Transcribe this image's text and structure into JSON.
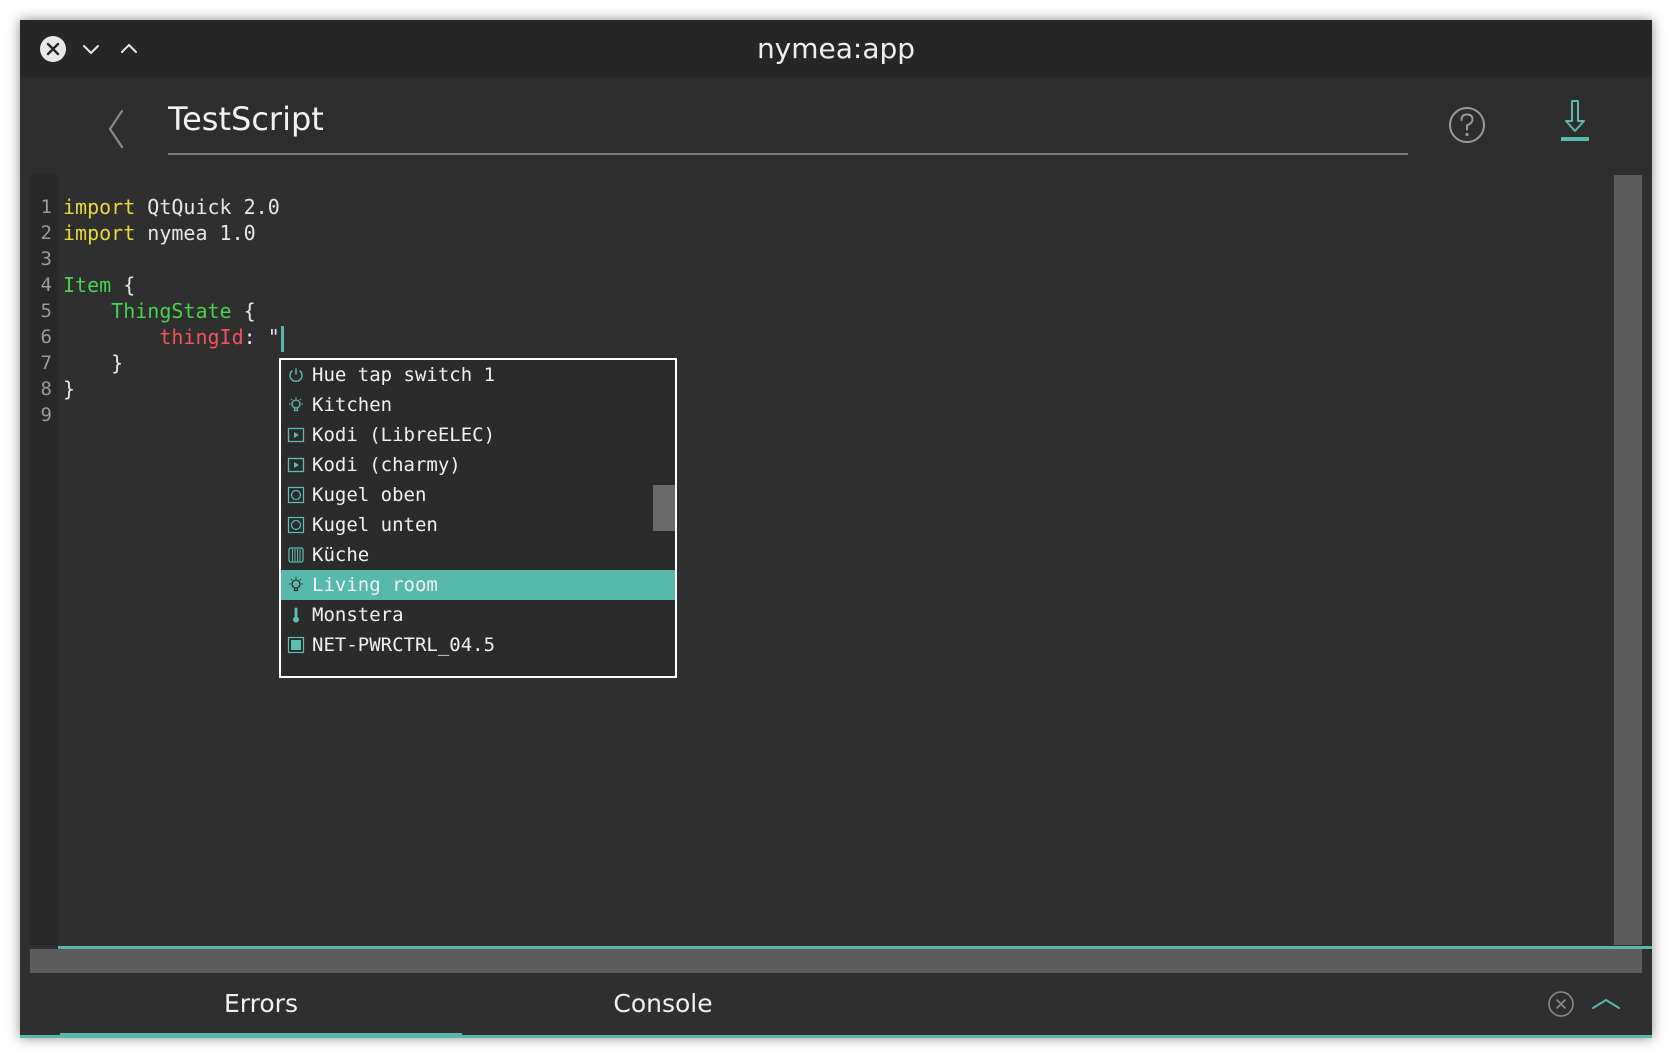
{
  "window": {
    "title": "nymea:app"
  },
  "header": {
    "script_name": "TestScript"
  },
  "editor": {
    "line_numbers": [
      "1",
      "2",
      "3",
      "4",
      "5",
      "6",
      "7",
      "8",
      "9"
    ],
    "lines": {
      "l1_kw": "import",
      "l1_rest": " QtQuick 2.0",
      "l2_kw": "import",
      "l2_rest": " nymea 1.0",
      "l4_type": "Item",
      "l4_rest": " {",
      "l5_indent": "    ",
      "l5_type": "ThingState",
      "l5_rest": " {",
      "l6_indent": "        ",
      "l6_prop": "thingId",
      "l6_rest": ": \"",
      "l7": "    }",
      "l8": "}"
    }
  },
  "completion": {
    "items": [
      {
        "label": "Hue tap switch 1",
        "icon": "power-icon"
      },
      {
        "label": "Kitchen",
        "icon": "light-bulb-icon"
      },
      {
        "label": "Kodi (LibreELEC)",
        "icon": "media-player-icon"
      },
      {
        "label": "Kodi (charmy)",
        "icon": "media-player-icon"
      },
      {
        "label": "Kugel oben",
        "icon": "lamp-icon"
      },
      {
        "label": "Kugel unten",
        "icon": "lamp-icon"
      },
      {
        "label": "Küche",
        "icon": "radiator-icon"
      },
      {
        "label": "Living room",
        "icon": "light-bulb-icon"
      },
      {
        "label": "Monstera",
        "icon": "thermometer-icon"
      },
      {
        "label": "NET-PWRCTRL_04.5",
        "icon": "power-socket-icon"
      }
    ],
    "selected_index": 7
  },
  "bottom_panel": {
    "tabs": [
      "Errors",
      "Console"
    ],
    "active_tab": "Errors"
  },
  "colors": {
    "accent": "#57b9ab",
    "keyword": "#e8d838",
    "type": "#46d24a",
    "property": "#f05458",
    "background": "#2f2f2f"
  }
}
